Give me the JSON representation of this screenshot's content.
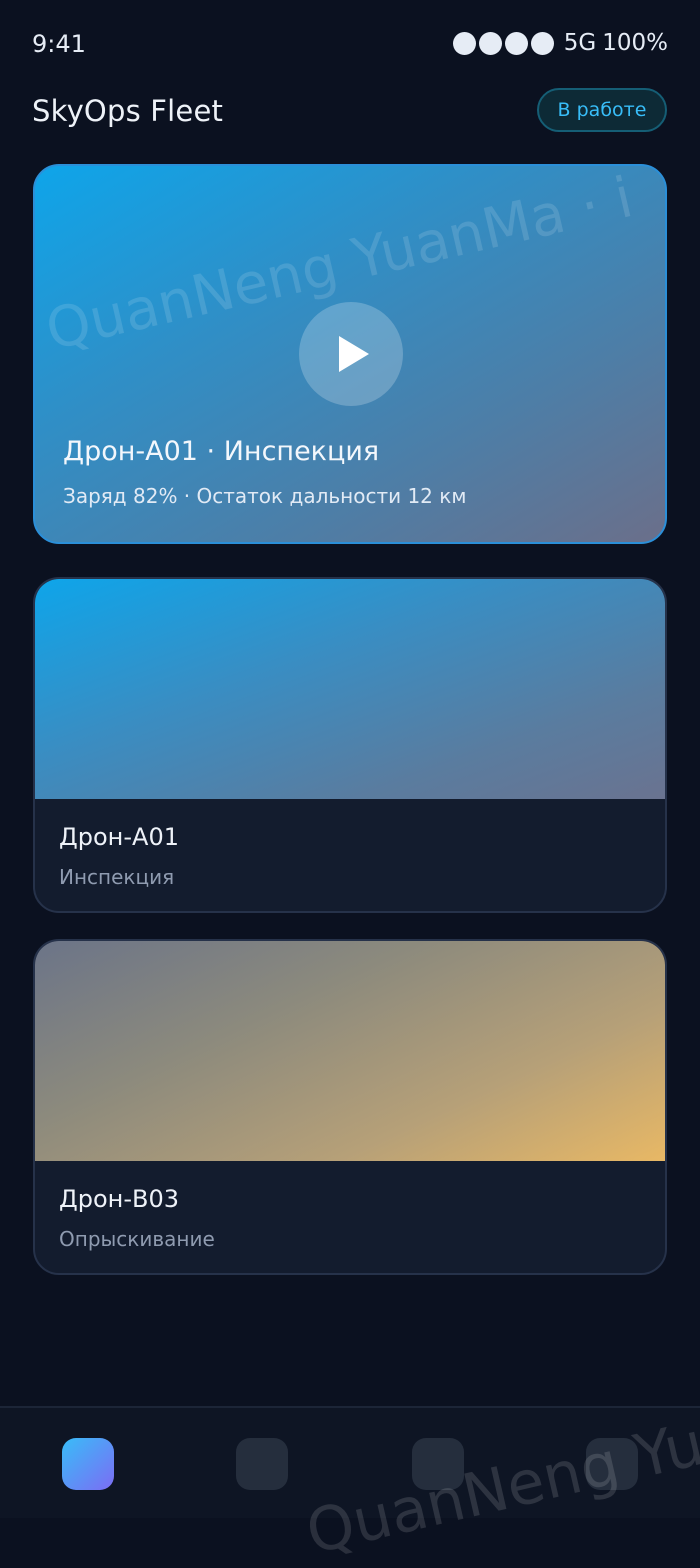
{
  "status_bar": {
    "time": "9:41",
    "network": "5G",
    "battery": "100%",
    "signal_bars": 4
  },
  "header": {
    "title": "SkyOps Fleet",
    "status_pill": "В работе"
  },
  "featured": {
    "title": "Дрон-A01 · Инспекция",
    "subtitle": "Заряд 82% · Остаток дальности 12 км"
  },
  "drones": [
    {
      "name": "Дрон-A01",
      "type": "Инспекция"
    },
    {
      "name": "Дрон-B03",
      "type": "Опрыскивание"
    }
  ],
  "bottom_nav": {
    "active_index": 0,
    "tab_count": 4
  },
  "watermark": "QuanNeng YuanMa · i",
  "colors": {
    "accent": "#38bdf8",
    "background": "#0b1120",
    "card": "#131c2e"
  }
}
